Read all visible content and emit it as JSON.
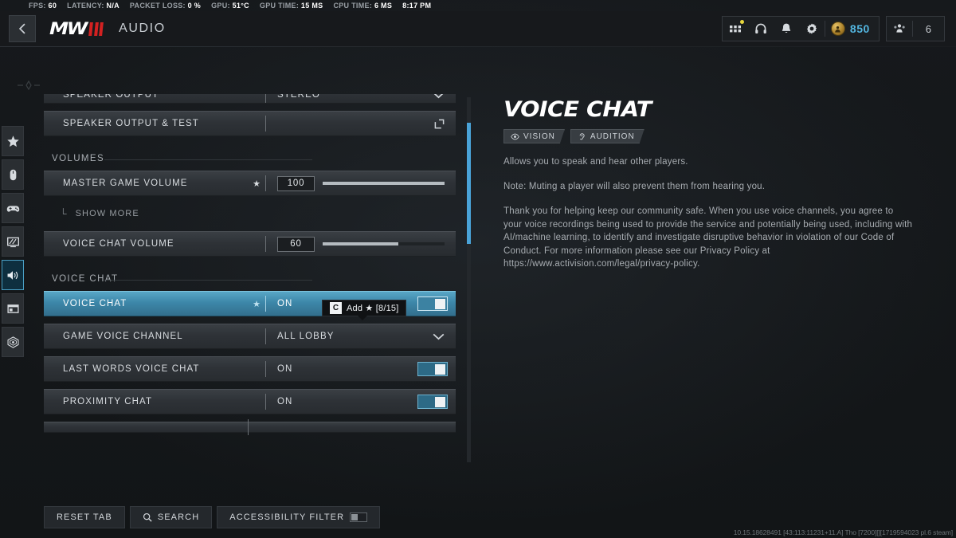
{
  "perf": {
    "stats": [
      {
        "label": "FPS:",
        "value": "60"
      },
      {
        "label": "LATENCY:",
        "value": "N/A"
      },
      {
        "label": "PACKET LOSS:",
        "value": "0 %"
      },
      {
        "label": "GPU:",
        "value": "51°C"
      },
      {
        "label": "GPU TIME:",
        "value": "15 MS"
      },
      {
        "label": "CPU TIME:",
        "value": "6 MS"
      },
      {
        "label": "",
        "value": "8:17 PM"
      }
    ]
  },
  "build_string": "10.15.18628491 [43:113:11231+11.A] Tho [7200][][1719594023 pl.6 steam]",
  "header": {
    "back_label": "Back",
    "logo_text": "MW",
    "title": "AUDIO",
    "icons": [
      {
        "name": "apps-grid-icon",
        "badge": true
      },
      {
        "name": "headphones-icon",
        "badge": false
      },
      {
        "name": "bell-icon",
        "badge": false
      },
      {
        "name": "gear-icon",
        "badge": false
      }
    ],
    "currency_value": "850",
    "party_count": "6"
  },
  "nav_rail": {
    "items": [
      {
        "name": "star-icon",
        "label": "Favorites",
        "active": false
      },
      {
        "name": "mouse-icon",
        "label": "Keyboard & Mouse",
        "active": false
      },
      {
        "name": "gamepad-icon",
        "label": "Controller",
        "active": false
      },
      {
        "name": "monitor-icon",
        "label": "Graphics",
        "active": false
      },
      {
        "name": "speaker-icon",
        "label": "Audio",
        "active": true
      },
      {
        "name": "interface-icon",
        "label": "Interface",
        "active": false
      },
      {
        "name": "account-icon",
        "label": "Account & Network",
        "active": false
      }
    ]
  },
  "settings": {
    "rows": [
      {
        "type": "dropdown",
        "label": "SPEAKER OUTPUT",
        "value": "STEREO",
        "star": false,
        "selected": false,
        "partial_top": true
      },
      {
        "type": "action",
        "label": "SPEAKER OUTPUT & TEST",
        "value": "",
        "star": false,
        "selected": false
      },
      {
        "type": "section",
        "label": "VOLUMES"
      },
      {
        "type": "slider",
        "label": "MASTER GAME VOLUME",
        "value": "100",
        "fill_percent": 100,
        "star": true,
        "selected": false
      },
      {
        "type": "submore",
        "label": "SHOW MORE"
      },
      {
        "type": "slider",
        "label": "VOICE CHAT VOLUME",
        "value": "60",
        "fill_percent": 62,
        "star": false,
        "selected": false
      },
      {
        "type": "section",
        "label": "VOICE CHAT"
      },
      {
        "type": "toggle",
        "label": "VOICE CHAT",
        "value": "ON",
        "star": true,
        "selected": true
      },
      {
        "type": "dropdown",
        "label": "GAME VOICE CHANNEL",
        "value": "ALL LOBBY",
        "star": false,
        "selected": false
      },
      {
        "type": "toggle",
        "label": "LAST WORDS VOICE CHAT",
        "value": "ON",
        "star": false,
        "selected": false
      },
      {
        "type": "toggle",
        "label": "PROXIMITY CHAT",
        "value": "ON",
        "star": false,
        "selected": false
      },
      {
        "type": "partial",
        "label": "",
        "value": ""
      }
    ]
  },
  "tooltip": {
    "key": "C",
    "text": "Add ★ [8/15]"
  },
  "info": {
    "title": "VOICE CHAT",
    "badges": [
      {
        "icon": "eye-icon",
        "label": "VISION"
      },
      {
        "icon": "ear-icon",
        "label": "AUDITION"
      }
    ],
    "description": "Allows you to speak and hear other players.",
    "note": "Note: Muting a player will also prevent them from hearing you.",
    "legal": "Thank you for helping keep our community safe. When you use voice channels, you agree to your voice recordings being used to provide the service and potentially being used, including with AI/machine learning, to identify and investigate disruptive behavior in violation of our Code of Conduct.  For more information please see our Privacy Policy at https://www.activision.com/legal/privacy-policy."
  },
  "bottom_bar": {
    "reset_label": "RESET TAB",
    "search_label": "SEARCH",
    "accessibility_label": "ACCESSIBILITY FILTER"
  },
  "colors": {
    "accent_blue": "#4aa3d8",
    "selected_row": "#3d87a9",
    "currency_cyan": "#53b6e0",
    "logo_red": "#d32121",
    "notify_yellow": "#e8d73c"
  }
}
